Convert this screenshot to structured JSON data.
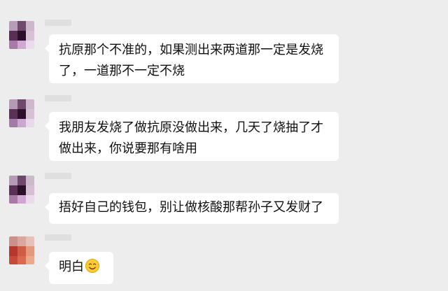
{
  "messages": [
    {
      "lines": [
        "抗原那个不准的，如果测出来两道那一定是发烧",
        "了，一道那不一定不烧"
      ]
    },
    {
      "lines": [
        "我朋友发烧了做抗原没做出来，几天了烧抽了才",
        "做出来，你说要那有啥用"
      ]
    },
    {
      "lines": [
        "捂好自己的钱包，别让做核酸那帮孙子又发财了"
      ]
    },
    {
      "lines": [
        "明白"
      ],
      "emoji": "smiling-face-emoji"
    }
  ],
  "colors": {
    "background": "#ededed",
    "bubble": "#ffffff",
    "text": "#111111"
  }
}
